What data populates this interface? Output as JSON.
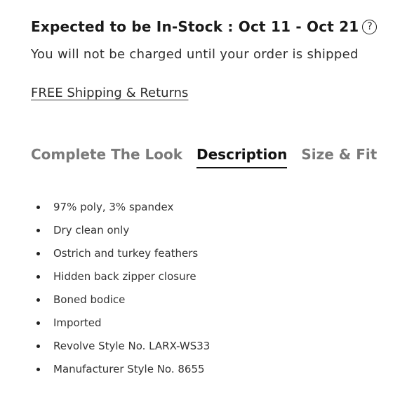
{
  "availability": {
    "title": "Expected to be In-Stock : Oct 11 - Oct 21",
    "help_icon_glyph": "?",
    "charge_note": "You will not be charged until your order is shipped"
  },
  "shipping": {
    "link_label": "FREE Shipping & Returns"
  },
  "tabs": [
    {
      "label": "Complete The Look",
      "active": false
    },
    {
      "label": "Description",
      "active": true
    },
    {
      "label": "Size & Fit",
      "active": false
    }
  ],
  "description": {
    "items": [
      "97% poly, 3% spandex",
      "Dry clean only",
      "Ostrich and turkey feathers",
      "Hidden back zipper closure",
      "Boned bodice",
      "Imported",
      "Revolve Style No. LARX-WS33",
      "Manufacturer Style No. 8655"
    ]
  }
}
